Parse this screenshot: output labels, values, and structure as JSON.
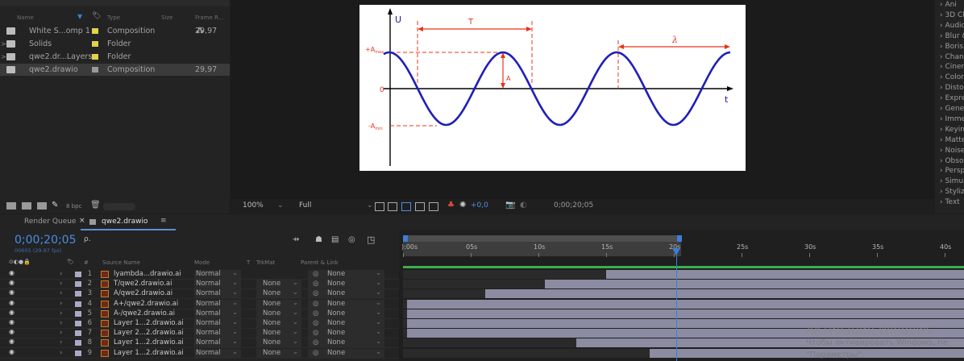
{
  "project": {
    "col_name": "Name",
    "col_type": "Type",
    "col_size": "Size",
    "col_frame": "Frame R...",
    "items": [
      {
        "name": "White S...omp 1",
        "type": "Composition",
        "frame": "29,97",
        "label_color": "#e3d24b",
        "twirl": ""
      },
      {
        "name": "Solids",
        "type": "Folder",
        "frame": "",
        "label_color": "#e3d24b",
        "twirl": ">"
      },
      {
        "name": "qwe2.dr...Layers",
        "type": "Folder",
        "frame": "",
        "label_color": "#e3d24b",
        "twirl": ">"
      },
      {
        "name": "qwe2.drawio",
        "type": "Composition",
        "frame": "29,97",
        "label_color": "#9a9a9a",
        "twirl": ""
      }
    ],
    "bpc": "8 bpc"
  },
  "viewer": {
    "zoom": "100%",
    "resolution": "Full",
    "exposure": "+0,0",
    "timecode": "0;00;20;05"
  },
  "figure": {
    "U": "U",
    "t": "t",
    "T": "T",
    "lambda": "λ",
    "A": "A",
    "Amax_prefix": "+A",
    "Amax_sub": "max",
    "Amin_prefix": "-A",
    "Amin_sub": "min",
    "zero": "0"
  },
  "effects": {
    "items": [
      "Ani",
      "3D Ch",
      "Audio",
      "Blur &",
      "Boris",
      "Chann",
      "Cinem",
      "Color",
      "Distor",
      "Expre",
      "Gener",
      "Imme",
      "Keyin",
      "Matte",
      "Noise",
      "Obsol",
      "Persp",
      "Simul",
      "Styliz",
      "Text"
    ]
  },
  "tabs": {
    "render_queue": "Render Queue",
    "comp": "qwe2.drawio"
  },
  "timeline": {
    "timecode": "0;00;20;05",
    "frames_fps": "00605 (29.97 fps)",
    "search_placeholder": "",
    "col_source": "Source Name",
    "col_mode": "Mode",
    "col_t": "T",
    "col_trkmat": "TrkMat",
    "col_parent": "Parent & Link",
    "ruler": [
      "):00s",
      "05s",
      "10s",
      "15s",
      "20s",
      "25s",
      "30s",
      "35s",
      "40s"
    ],
    "playhead_seconds": 20.2,
    "layers": [
      {
        "num": "1",
        "name": "lyambda...drawio.ai",
        "mode": "Normal",
        "trkmat": "",
        "parent": "None",
        "start_seconds": 15.0
      },
      {
        "num": "2",
        "name": "T/qwe2.drawio.ai",
        "mode": "Normal",
        "trkmat": "None",
        "parent": "None",
        "start_seconds": 10.5
      },
      {
        "num": "3",
        "name": "A/qwe2.drawio.ai",
        "mode": "Normal",
        "trkmat": "None",
        "parent": "None",
        "start_seconds": 6.1
      },
      {
        "num": "4",
        "name": "A+/qwe2.drawio.ai",
        "mode": "Normal",
        "trkmat": "None",
        "parent": "None",
        "start_seconds": 0.3
      },
      {
        "num": "5",
        "name": "A-/qwe2.drawio.ai",
        "mode": "Normal",
        "trkmat": "None",
        "parent": "None",
        "start_seconds": 0.3
      },
      {
        "num": "6",
        "name": "Layer 1...2.drawio.ai",
        "mode": "Normal",
        "trkmat": "None",
        "parent": "None",
        "start_seconds": 0.3
      },
      {
        "num": "7",
        "name": "Layer 2...2.drawio.ai",
        "mode": "Normal",
        "trkmat": "None",
        "parent": "None",
        "start_seconds": 0.3
      },
      {
        "num": "8",
        "name": "Layer 1...2.drawio.ai",
        "mode": "Normal",
        "trkmat": "None",
        "parent": "None",
        "start_seconds": 12.8
      },
      {
        "num": "9",
        "name": "Layer 1...2.drawio.ai",
        "mode": "Normal",
        "trkmat": "None",
        "parent": "None",
        "start_seconds": 18.2
      }
    ]
  },
  "watermark": {
    "title": "Активация Windows",
    "line1": "Чтобы активировать Windows, пе",
    "line2": "\"Параметры\"."
  }
}
